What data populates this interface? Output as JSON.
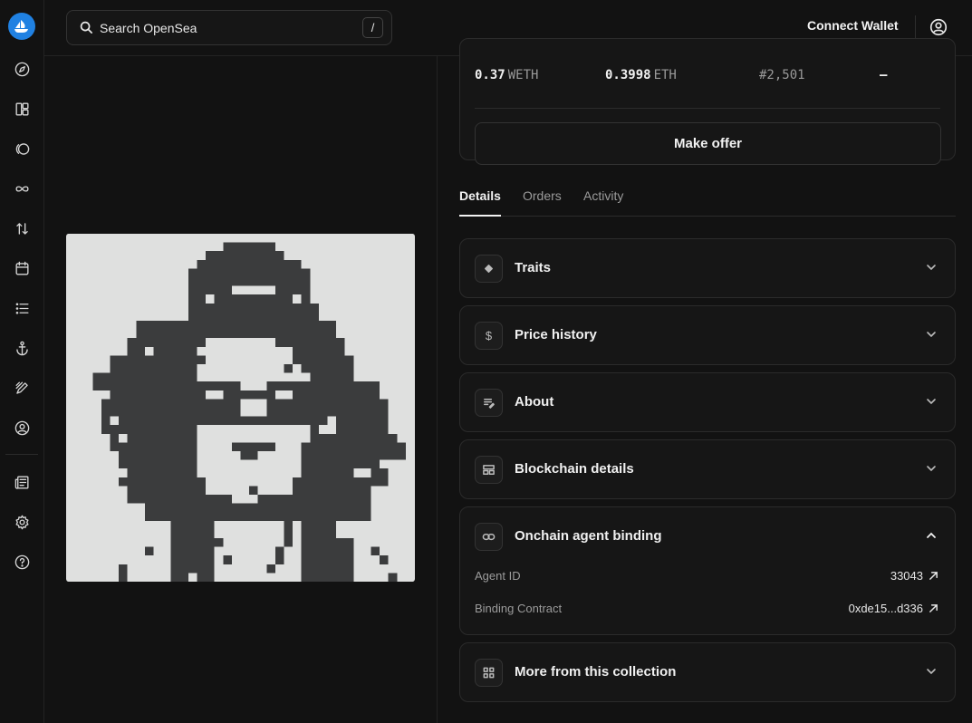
{
  "sidebar": {
    "logo": "opensea-logo",
    "items": [
      {
        "icon": "compass-icon"
      },
      {
        "icon": "layout-icon"
      },
      {
        "icon": "tokens-icon"
      },
      {
        "icon": "infinity-icon"
      },
      {
        "icon": "swap-icon"
      },
      {
        "icon": "calendar-icon"
      },
      {
        "icon": "list-icon"
      },
      {
        "icon": "anchor-icon"
      },
      {
        "icon": "pen-icon"
      },
      {
        "icon": "profile-icon"
      }
    ],
    "bottom_items": [
      {
        "icon": "news-icon"
      },
      {
        "icon": "settings-icon"
      },
      {
        "icon": "help-icon"
      }
    ]
  },
  "topbar": {
    "search_placeholder": "Search OpenSea",
    "search_shortcut": "/",
    "connect_label": "Connect Wallet"
  },
  "price": {
    "best_offer_value": "0.37",
    "best_offer_unit": "WETH",
    "last_sale_value": "0.3998",
    "last_sale_unit": "ETH",
    "rank": "#2,501",
    "extra": "–",
    "make_offer_label": "Make offer"
  },
  "tabs": [
    "Details",
    "Orders",
    "Activity"
  ],
  "active_tab": "Details",
  "sections": {
    "traits": "Traits",
    "price_history": "Price history",
    "about": "About",
    "blockchain": "Blockchain details",
    "agent_binding": "Onchain agent binding",
    "more": "More from this collection"
  },
  "agent_binding": {
    "agent_id_label": "Agent ID",
    "agent_id_value": "33043",
    "contract_label": "Binding Contract",
    "contract_value": "0xde15...d336"
  },
  "colors": {
    "background": "#121212",
    "card": "#161616",
    "accent": "#2081e2",
    "nft_dark": "#3b3c3d",
    "nft_light": "#dfe0df"
  }
}
